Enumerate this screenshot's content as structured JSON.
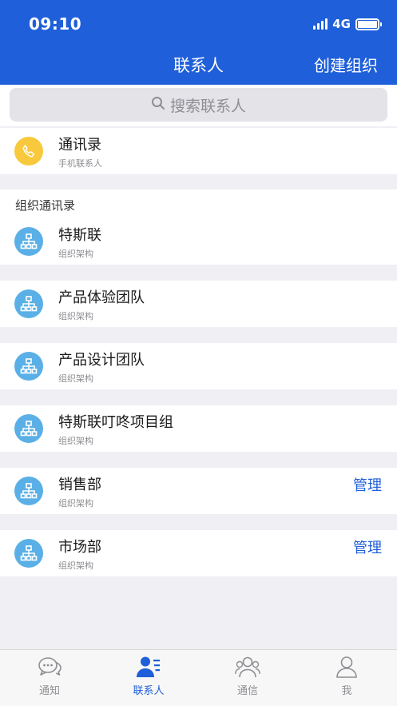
{
  "status_bar": {
    "time": "09:10",
    "network": "4G"
  },
  "header": {
    "title": "联系人",
    "action": "创建组织"
  },
  "search": {
    "placeholder": "搜索联系人"
  },
  "phone_contacts": {
    "title": "通讯录",
    "subtitle": "手机联系人"
  },
  "section_label": "组织通讯录",
  "orgs": [
    {
      "title": "特斯联",
      "subtitle": "组织架构",
      "action": ""
    },
    {
      "title": "产品体验团队",
      "subtitle": "组织架构",
      "action": ""
    },
    {
      "title": "产品设计团队",
      "subtitle": "组织架构",
      "action": ""
    },
    {
      "title": "特斯联叮咚项目组",
      "subtitle": "组织架构",
      "action": ""
    },
    {
      "title": "销售部",
      "subtitle": "组织架构",
      "action": "管理"
    },
    {
      "title": "市场部",
      "subtitle": "组织架构",
      "action": "管理"
    }
  ],
  "tabs": [
    {
      "label": "通知",
      "icon": "chat-bubble-icon",
      "active": false
    },
    {
      "label": "联系人",
      "icon": "contacts-icon",
      "active": true
    },
    {
      "label": "通信",
      "icon": "group-icon",
      "active": false
    },
    {
      "label": "我",
      "icon": "person-icon",
      "active": false
    }
  ],
  "colors": {
    "brand": "#1f5fd9",
    "org_icon": "#5ab0e6",
    "phone_icon": "#f8c93c",
    "background": "#efeff4"
  }
}
